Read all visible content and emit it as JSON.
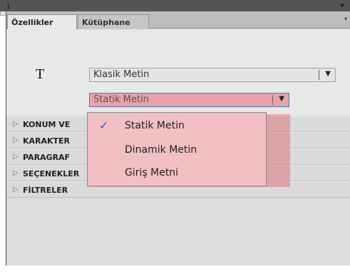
{
  "tabs": [
    {
      "label": "Özellikler"
    },
    {
      "label": "Kütüphane"
    }
  ],
  "collapse_symbol": "▾",
  "type_icon_glyph": "T",
  "text_type": {
    "value": "Klasik Metin",
    "arrow": "▼"
  },
  "text_subtype": {
    "value": "Statik Metin",
    "arrow": "▼"
  },
  "align_dropdown": {
    "icon": "⇂",
    "arrow": "▼"
  },
  "sections": [
    {
      "label": "KONUM VE"
    },
    {
      "label": "KARAKTER"
    },
    {
      "label": "PARAGRAF"
    },
    {
      "label": "SEÇENEKLER"
    },
    {
      "label": "FİLTRELER"
    }
  ],
  "section_triangle": "▷",
  "dropdown": {
    "options": [
      {
        "label": "Statik Metin",
        "selected": true
      },
      {
        "label": "Dinamik Metin",
        "selected": false
      },
      {
        "label": "Giriş Metni",
        "selected": false
      }
    ],
    "check_glyph": "✓"
  },
  "colors": {
    "highlight": "#e9a2a6",
    "focus_border": "#3c7fc7",
    "panel_bg": "#dcdcdc"
  }
}
